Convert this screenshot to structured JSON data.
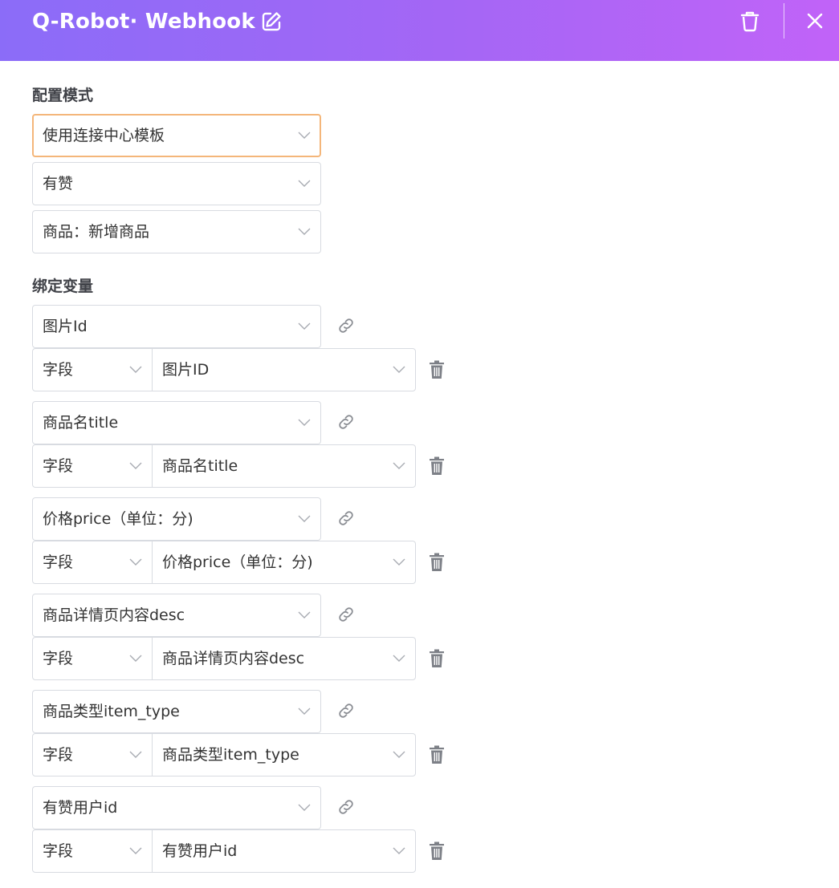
{
  "header": {
    "title": "Q-Robot· Webhook",
    "edit_icon": "edit-icon",
    "trash_icon": "trash-icon",
    "close_icon": "close-icon",
    "gradient_start": "#8b6cf8",
    "gradient_end": "#c163f8"
  },
  "config": {
    "label": "配置模式",
    "mode_select": "使用连接中心模板",
    "app_select": "有赞",
    "event_select": "商品：新增商品"
  },
  "bindings": {
    "label": "绑定变量",
    "items": [
      {
        "variable": "图片Id",
        "source_type": "字段",
        "source_value": "图片ID"
      },
      {
        "variable": "商品名title",
        "source_type": "字段",
        "source_value": "商品名title"
      },
      {
        "variable": "价格price（单位：分)",
        "source_type": "字段",
        "source_value": "价格price（单位：分)"
      },
      {
        "variable": "商品详情页内容desc",
        "source_type": "字段",
        "source_value": "商品详情页内容desc"
      },
      {
        "variable": "商品类型item_type",
        "source_type": "字段",
        "source_value": "商品类型item_type"
      },
      {
        "variable": "有赞用户id",
        "source_type": "字段",
        "source_value": "有赞用户id"
      }
    ]
  },
  "colors": {
    "focus_border": "#f4b67a",
    "border": "#d8dbe1",
    "icon_gray": "#8a8d93"
  }
}
